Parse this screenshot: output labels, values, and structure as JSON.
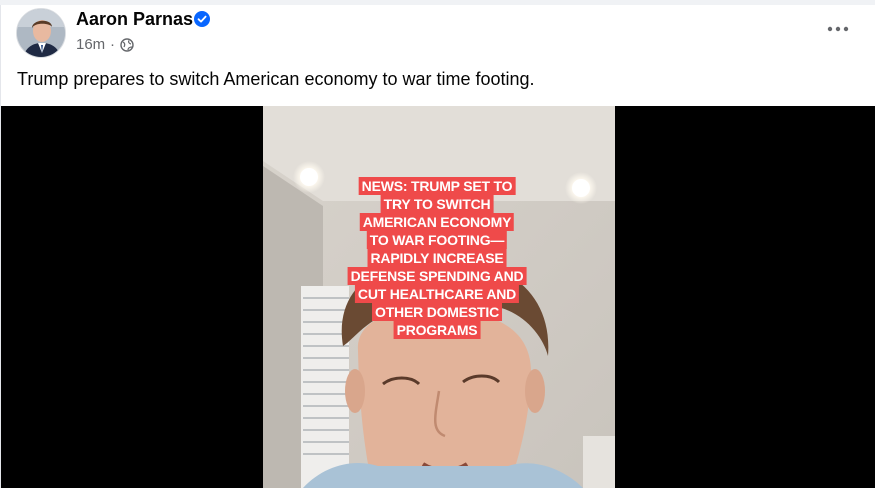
{
  "post": {
    "author": "Aaron Parnas",
    "time": "16m",
    "separator": "·",
    "text": "Trump prepares to switch American economy to war time footing."
  },
  "icons": {
    "verified": "verified-badge-icon",
    "audience": "globe-icon",
    "more": "more-options-icon"
  },
  "colors": {
    "verified": "#0866ff",
    "caption_bg": "#ef4a4a",
    "meta_text": "#65676b"
  },
  "video": {
    "caption_lines": [
      "NEWS: TRUMP SET TO",
      "TRY TO SWITCH",
      "AMERICAN ECONOMY",
      "TO WAR FOOTING—",
      "RAPIDLY INCREASE",
      "DEFENSE SPENDING AND",
      "CUT HEALTHCARE AND",
      "OTHER DOMESTIC",
      "PROGRAMS"
    ]
  }
}
